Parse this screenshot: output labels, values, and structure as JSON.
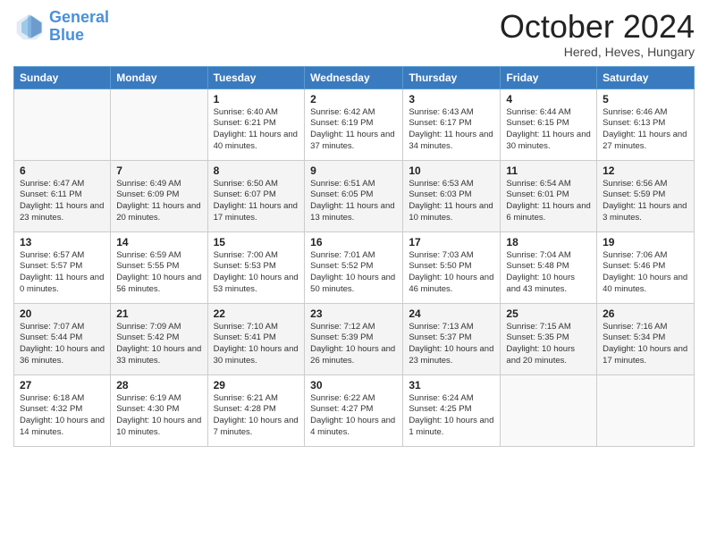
{
  "header": {
    "logo_line1": "General",
    "logo_line2": "Blue",
    "month": "October 2024",
    "location": "Hered, Heves, Hungary"
  },
  "days_of_week": [
    "Sunday",
    "Monday",
    "Tuesday",
    "Wednesday",
    "Thursday",
    "Friday",
    "Saturday"
  ],
  "weeks": [
    [
      {
        "day": "",
        "info": ""
      },
      {
        "day": "",
        "info": ""
      },
      {
        "day": "1",
        "info": "Sunrise: 6:40 AM\nSunset: 6:21 PM\nDaylight: 11 hours and 40 minutes."
      },
      {
        "day": "2",
        "info": "Sunrise: 6:42 AM\nSunset: 6:19 PM\nDaylight: 11 hours and 37 minutes."
      },
      {
        "day": "3",
        "info": "Sunrise: 6:43 AM\nSunset: 6:17 PM\nDaylight: 11 hours and 34 minutes."
      },
      {
        "day": "4",
        "info": "Sunrise: 6:44 AM\nSunset: 6:15 PM\nDaylight: 11 hours and 30 minutes."
      },
      {
        "day": "5",
        "info": "Sunrise: 6:46 AM\nSunset: 6:13 PM\nDaylight: 11 hours and 27 minutes."
      }
    ],
    [
      {
        "day": "6",
        "info": "Sunrise: 6:47 AM\nSunset: 6:11 PM\nDaylight: 11 hours and 23 minutes."
      },
      {
        "day": "7",
        "info": "Sunrise: 6:49 AM\nSunset: 6:09 PM\nDaylight: 11 hours and 20 minutes."
      },
      {
        "day": "8",
        "info": "Sunrise: 6:50 AM\nSunset: 6:07 PM\nDaylight: 11 hours and 17 minutes."
      },
      {
        "day": "9",
        "info": "Sunrise: 6:51 AM\nSunset: 6:05 PM\nDaylight: 11 hours and 13 minutes."
      },
      {
        "day": "10",
        "info": "Sunrise: 6:53 AM\nSunset: 6:03 PM\nDaylight: 11 hours and 10 minutes."
      },
      {
        "day": "11",
        "info": "Sunrise: 6:54 AM\nSunset: 6:01 PM\nDaylight: 11 hours and 6 minutes."
      },
      {
        "day": "12",
        "info": "Sunrise: 6:56 AM\nSunset: 5:59 PM\nDaylight: 11 hours and 3 minutes."
      }
    ],
    [
      {
        "day": "13",
        "info": "Sunrise: 6:57 AM\nSunset: 5:57 PM\nDaylight: 11 hours and 0 minutes."
      },
      {
        "day": "14",
        "info": "Sunrise: 6:59 AM\nSunset: 5:55 PM\nDaylight: 10 hours and 56 minutes."
      },
      {
        "day": "15",
        "info": "Sunrise: 7:00 AM\nSunset: 5:53 PM\nDaylight: 10 hours and 53 minutes."
      },
      {
        "day": "16",
        "info": "Sunrise: 7:01 AM\nSunset: 5:52 PM\nDaylight: 10 hours and 50 minutes."
      },
      {
        "day": "17",
        "info": "Sunrise: 7:03 AM\nSunset: 5:50 PM\nDaylight: 10 hours and 46 minutes."
      },
      {
        "day": "18",
        "info": "Sunrise: 7:04 AM\nSunset: 5:48 PM\nDaylight: 10 hours and 43 minutes."
      },
      {
        "day": "19",
        "info": "Sunrise: 7:06 AM\nSunset: 5:46 PM\nDaylight: 10 hours and 40 minutes."
      }
    ],
    [
      {
        "day": "20",
        "info": "Sunrise: 7:07 AM\nSunset: 5:44 PM\nDaylight: 10 hours and 36 minutes."
      },
      {
        "day": "21",
        "info": "Sunrise: 7:09 AM\nSunset: 5:42 PM\nDaylight: 10 hours and 33 minutes."
      },
      {
        "day": "22",
        "info": "Sunrise: 7:10 AM\nSunset: 5:41 PM\nDaylight: 10 hours and 30 minutes."
      },
      {
        "day": "23",
        "info": "Sunrise: 7:12 AM\nSunset: 5:39 PM\nDaylight: 10 hours and 26 minutes."
      },
      {
        "day": "24",
        "info": "Sunrise: 7:13 AM\nSunset: 5:37 PM\nDaylight: 10 hours and 23 minutes."
      },
      {
        "day": "25",
        "info": "Sunrise: 7:15 AM\nSunset: 5:35 PM\nDaylight: 10 hours and 20 minutes."
      },
      {
        "day": "26",
        "info": "Sunrise: 7:16 AM\nSunset: 5:34 PM\nDaylight: 10 hours and 17 minutes."
      }
    ],
    [
      {
        "day": "27",
        "info": "Sunrise: 6:18 AM\nSunset: 4:32 PM\nDaylight: 10 hours and 14 minutes."
      },
      {
        "day": "28",
        "info": "Sunrise: 6:19 AM\nSunset: 4:30 PM\nDaylight: 10 hours and 10 minutes."
      },
      {
        "day": "29",
        "info": "Sunrise: 6:21 AM\nSunset: 4:28 PM\nDaylight: 10 hours and 7 minutes."
      },
      {
        "day": "30",
        "info": "Sunrise: 6:22 AM\nSunset: 4:27 PM\nDaylight: 10 hours and 4 minutes."
      },
      {
        "day": "31",
        "info": "Sunrise: 6:24 AM\nSunset: 4:25 PM\nDaylight: 10 hours and 1 minute."
      },
      {
        "day": "",
        "info": ""
      },
      {
        "day": "",
        "info": ""
      }
    ]
  ]
}
